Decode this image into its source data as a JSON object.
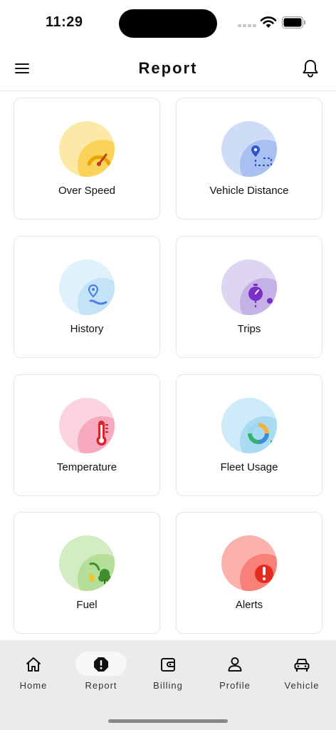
{
  "status_bar": {
    "time": "11:29"
  },
  "header": {
    "title": "Report"
  },
  "reports": [
    {
      "label": "Over Speed",
      "outer": "#fde9a7",
      "inner": "#fbd35a",
      "icon_color": "#c0392b"
    },
    {
      "label": "Vehicle Distance",
      "outer": "#cfdcf7",
      "inner": "#a8c1f0",
      "icon_color": "#2f55c8"
    },
    {
      "label": "History",
      "outer": "#dff2fb",
      "inner": "#c3e4f6",
      "icon_color": "#4f7ee6"
    },
    {
      "label": "Trips",
      "outer": "#ddd5f1",
      "inner": "#c4b1e6",
      "icon_color": "#7a2fc9"
    },
    {
      "label": "Temperature",
      "outer": "#fbd3de",
      "inner": "#f7a9bd",
      "icon_color": "#d9252f"
    },
    {
      "label": "Fleet Usage",
      "outer": "#cdebf9",
      "inner": "#a9dbf3",
      "icon_color": "#34b36a"
    },
    {
      "label": "Fuel",
      "outer": "#d3ecc2",
      "inner": "#b5de98",
      "icon_color": "#3e8e2f"
    },
    {
      "label": "Alerts",
      "outer": "#fbb2ad",
      "inner": "#f78078",
      "icon_color": "#e62a20"
    }
  ],
  "bottom_nav": {
    "items": [
      {
        "label": "Home",
        "icon": "home-icon"
      },
      {
        "label": "Report",
        "icon": "report-icon",
        "active": true
      },
      {
        "label": "Billing",
        "icon": "wallet-icon"
      },
      {
        "label": "Profile",
        "icon": "user-icon"
      },
      {
        "label": "Vehicle",
        "icon": "car-icon"
      }
    ]
  }
}
